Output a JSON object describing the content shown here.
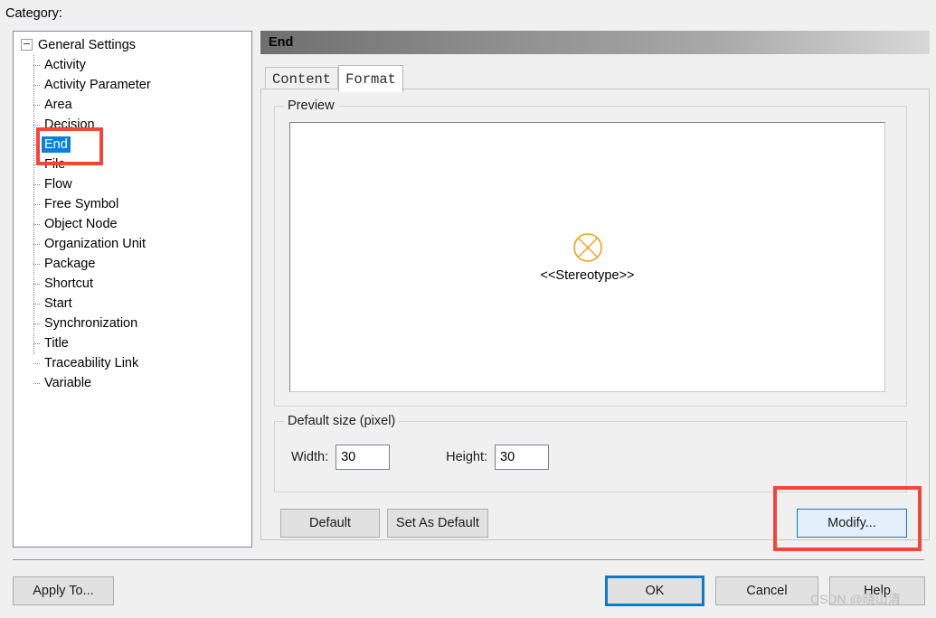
{
  "dialog": {
    "category_label": "Category:"
  },
  "tree": {
    "root": {
      "label": "General Settings",
      "expander_icon": "collapse-minus-icon"
    },
    "items": [
      {
        "label": "Activity",
        "selected": false
      },
      {
        "label": "Activity Parameter",
        "selected": false
      },
      {
        "label": "Area",
        "selected": false
      },
      {
        "label": "Decision",
        "selected": false
      },
      {
        "label": "End",
        "selected": true
      },
      {
        "label": "File",
        "selected": false
      },
      {
        "label": "Flow",
        "selected": false
      },
      {
        "label": "Free Symbol",
        "selected": false
      },
      {
        "label": "Object Node",
        "selected": false
      },
      {
        "label": "Organization Unit",
        "selected": false
      },
      {
        "label": "Package",
        "selected": false
      },
      {
        "label": "Shortcut",
        "selected": false
      },
      {
        "label": "Start",
        "selected": false
      },
      {
        "label": "Synchronization",
        "selected": false
      },
      {
        "label": "Title",
        "selected": false
      },
      {
        "label": "Traceability Link",
        "selected": false
      },
      {
        "label": "Variable",
        "selected": false
      }
    ]
  },
  "panel": {
    "header_title": "End",
    "tabs": [
      {
        "label": "Content",
        "active": false
      },
      {
        "label": "Format",
        "active": true
      }
    ],
    "preview": {
      "legend": "Preview",
      "symbol_icon": "end-node-circle-x-icon",
      "symbol_color": "#F59E22",
      "stereotype_label": "<<Stereotype>>"
    },
    "default_size": {
      "legend": "Default size (pixel)",
      "width_label": "Width:",
      "width_value": "30",
      "height_label": "Height:",
      "height_value": "30"
    },
    "buttons": {
      "default": "Default",
      "set_as_default": "Set As Default",
      "modify": "Modify..."
    }
  },
  "footer": {
    "apply_to": "Apply To...",
    "ok": "OK",
    "cancel": "Cancel",
    "help": "Help"
  },
  "watermark": {
    "text": "CSDN @晓山清"
  },
  "annotations": {
    "highlight_color": "#F4453A"
  }
}
